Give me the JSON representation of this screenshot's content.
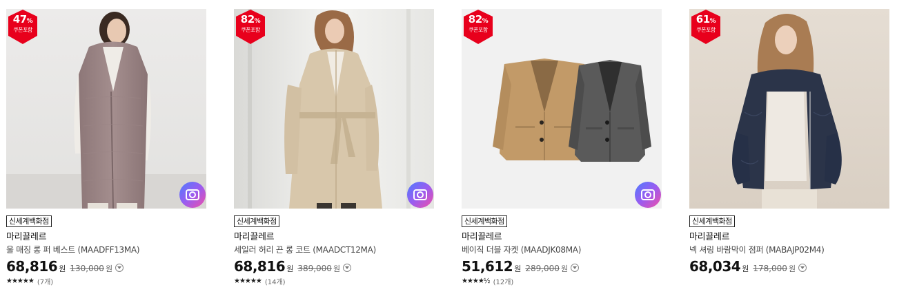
{
  "colors": {
    "badge": "#e8001c",
    "price": "#111111",
    "camera_gradient": [
      "#6d5cff",
      "#e84fc0"
    ]
  },
  "products": [
    {
      "discount_number": "47",
      "discount_unit": "%",
      "coupon_label": "쿠폰포함",
      "store_label": "신세계백화점",
      "brand": "마리끌레르",
      "name": "울 매징 롱 퍼 베스트 (MAADFF13MA)",
      "price": "68,816",
      "price_unit": "원",
      "original_price": "130,000",
      "original_unit": "원",
      "stars": "★★★★★",
      "rating_value": 5,
      "review_count": "(7개)",
      "has_camera_icon": true,
      "image_icon": "model-fur-vest-photo"
    },
    {
      "discount_number": "82",
      "discount_unit": "%",
      "coupon_label": "쿠폰포함",
      "store_label": "신세계백화점",
      "brand": "마리끌레르",
      "name": "세일러 허리 끈 롱 코트 (MAADCT12MA)",
      "price": "68,816",
      "price_unit": "원",
      "original_price": "389,000",
      "original_unit": "원",
      "stars": "★★★★★",
      "rating_value": 5,
      "review_count": "(14개)",
      "has_camera_icon": true,
      "image_icon": "model-long-coat-photo"
    },
    {
      "discount_number": "82",
      "discount_unit": "%",
      "coupon_label": "쿠폰포함",
      "store_label": "신세계백화점",
      "brand": "마리끌레르",
      "name": "베이직 더블 자켓 (MAADJK08MA)",
      "price": "51,612",
      "price_unit": "원",
      "original_price": "289,000",
      "original_unit": "원",
      "stars": "★★★★½",
      "rating_value": 4.5,
      "review_count": "(12개)",
      "has_camera_icon": true,
      "image_icon": "two-jackets-photo"
    },
    {
      "discount_number": "61",
      "discount_unit": "%",
      "coupon_label": "쿠폰포함",
      "store_label": "신세계백화점",
      "brand": "마리끌레르",
      "name": "넥 셔링 바람막이 점퍼 (MABAJP02M4)",
      "price": "68,034",
      "price_unit": "원",
      "original_price": "178,000",
      "original_unit": "원",
      "has_camera_icon": false,
      "image_icon": "model-windbreaker-photo"
    }
  ]
}
